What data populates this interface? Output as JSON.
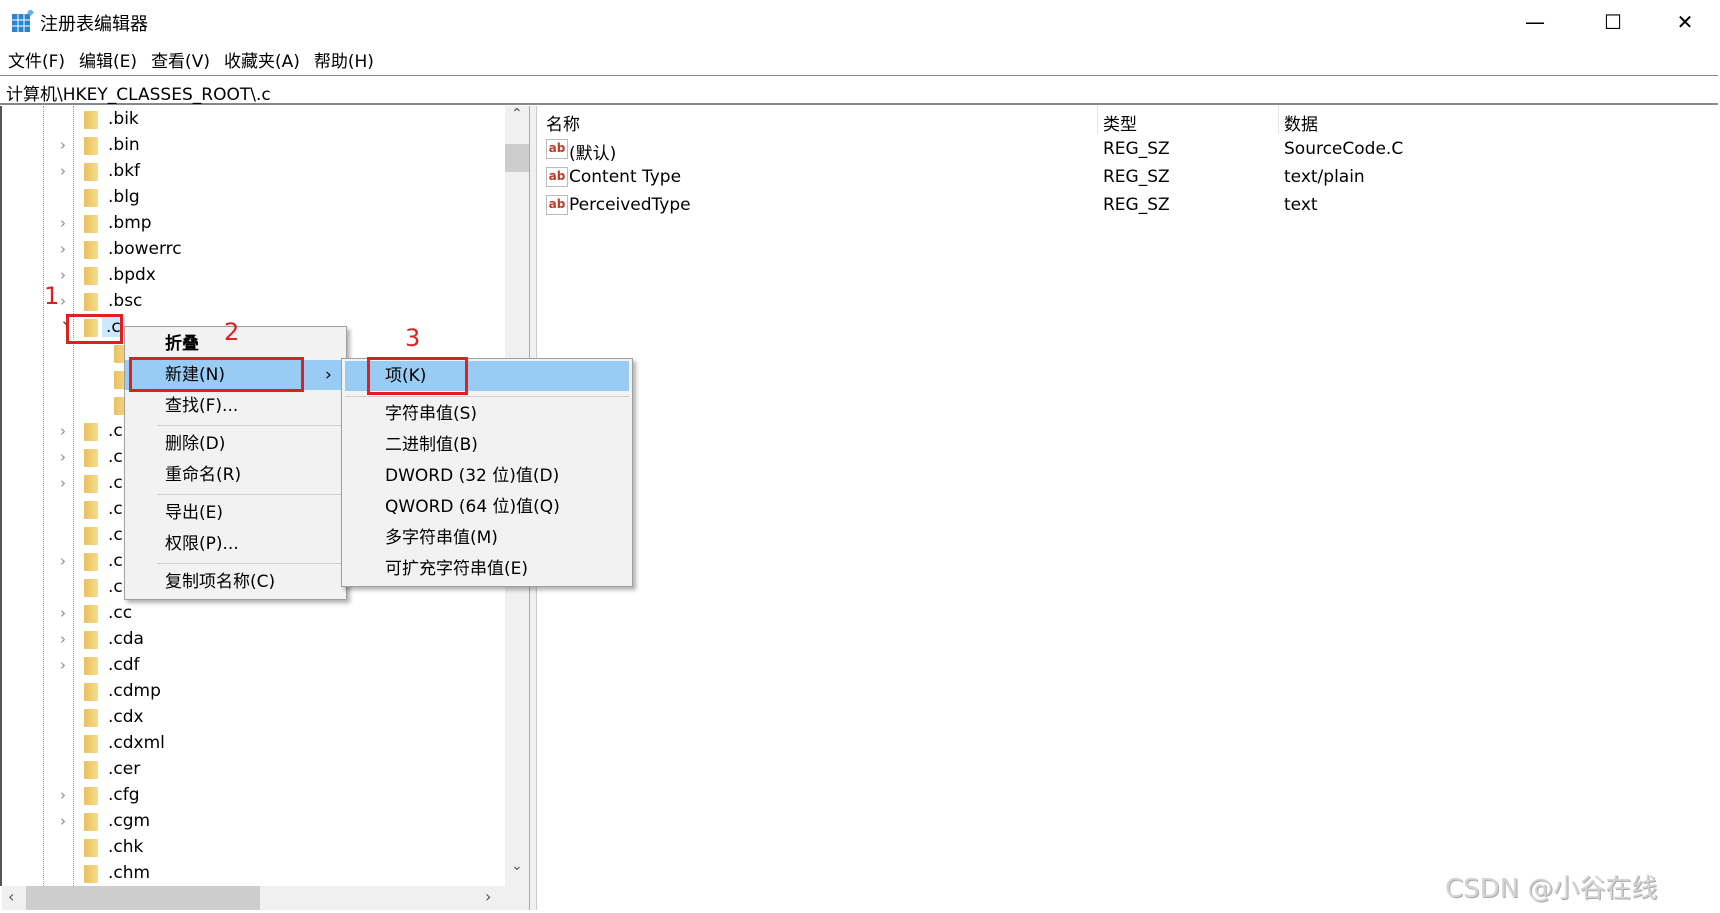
{
  "window": {
    "title": "注册表编辑器",
    "minimize": "—",
    "maximize": "☐",
    "close": "✕"
  },
  "menu": [
    "文件(F)",
    "编辑(E)",
    "查看(V)",
    "收藏夹(A)",
    "帮助(H)"
  ],
  "address": "计算机\\HKEY_CLASSES_ROOT\\.c",
  "tree": [
    {
      "label": ".bik",
      "chevron": false
    },
    {
      "label": ".bin",
      "chevron": true
    },
    {
      "label": ".bkf",
      "chevron": true
    },
    {
      "label": ".blg",
      "chevron": false
    },
    {
      "label": ".bmp",
      "chevron": true
    },
    {
      "label": ".bowerrc",
      "chevron": true
    },
    {
      "label": ".bpdx",
      "chevron": true
    },
    {
      "label": ".bsc",
      "chevron": true
    },
    {
      "label": ".c",
      "chevron": "expanded",
      "selected": true
    },
    {
      "label": "",
      "chevron": false,
      "child": true
    },
    {
      "label": "",
      "chevron": false,
      "child": true
    },
    {
      "label": "",
      "chevron": false,
      "child": true
    },
    {
      "label": ".c",
      "chevron": true
    },
    {
      "label": ".c",
      "chevron": true
    },
    {
      "label": ".c",
      "chevron": true
    },
    {
      "label": ".c",
      "chevron": false
    },
    {
      "label": ".c",
      "chevron": false
    },
    {
      "label": ".c",
      "chevron": true
    },
    {
      "label": ".c",
      "chevron": false
    },
    {
      "label": ".cc",
      "chevron": true
    },
    {
      "label": ".cda",
      "chevron": true
    },
    {
      "label": ".cdf",
      "chevron": true
    },
    {
      "label": ".cdmp",
      "chevron": false
    },
    {
      "label": ".cdx",
      "chevron": false
    },
    {
      "label": ".cdxml",
      "chevron": false
    },
    {
      "label": ".cer",
      "chevron": false
    },
    {
      "label": ".cfg",
      "chevron": true
    },
    {
      "label": ".cgm",
      "chevron": true
    },
    {
      "label": ".chk",
      "chevron": false
    },
    {
      "label": ".chm",
      "chevron": false
    }
  ],
  "values": {
    "headers": {
      "name": "名称",
      "type": "类型",
      "data": "数据"
    },
    "rows": [
      {
        "name": "(默认)",
        "type": "REG_SZ",
        "data": "SourceCode.C"
      },
      {
        "name": "Content Type",
        "type": "REG_SZ",
        "data": "text/plain"
      },
      {
        "name": "PerceivedType",
        "type": "REG_SZ",
        "data": "text"
      }
    ],
    "icon_text": "ab"
  },
  "context_menu": {
    "collapse": "折叠",
    "new": "新建(N)",
    "find": "查找(F)...",
    "delete": "删除(D)",
    "rename": "重命名(R)",
    "export": "导出(E)",
    "permissions": "权限(P)...",
    "copy_key_name": "复制项名称(C)",
    "submenu_arrow": "›"
  },
  "submenu": {
    "key": "项(K)",
    "string": "字符串值(S)",
    "binary": "二进制值(B)",
    "dword": "DWORD (32 位)值(D)",
    "qword": "QWORD (64 位)值(Q)",
    "multi_string": "多字符串值(M)",
    "expandable_string": "可扩充字符串值(E)"
  },
  "annotations": [
    "1",
    "2",
    "3"
  ],
  "watermark": "CSDN @小谷在线",
  "colors": {
    "highlight": "#99ccf5",
    "annotation": "#e02020",
    "selected": "#cce8ff"
  }
}
